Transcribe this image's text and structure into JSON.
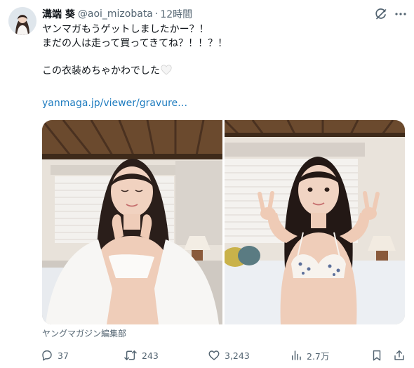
{
  "tweet": {
    "display_name": "溝端 葵",
    "handle": "@aoi_mizobata",
    "separator": "·",
    "time": "12時間",
    "lines": [
      "ヤンマガもうゲットしましたかー？！",
      "まだの人は走って買ってきてね？！！？！",
      "",
      "この衣装めちゃかわでした"
    ],
    "link_text": "yanmaga.jp/viewer/gravure…",
    "media_source": "ヤングマガジン編集部"
  },
  "icons": {
    "header": [
      "grok-icon",
      "more-icon"
    ],
    "inline": "white-heart-emoji"
  },
  "actions": {
    "reply_count": "37",
    "retweet_count": "243",
    "like_count": "3,243",
    "view_count": "2.7万"
  },
  "colors": {
    "text": "#0f1419",
    "secondary": "#536471",
    "link": "#1d7bbf"
  }
}
